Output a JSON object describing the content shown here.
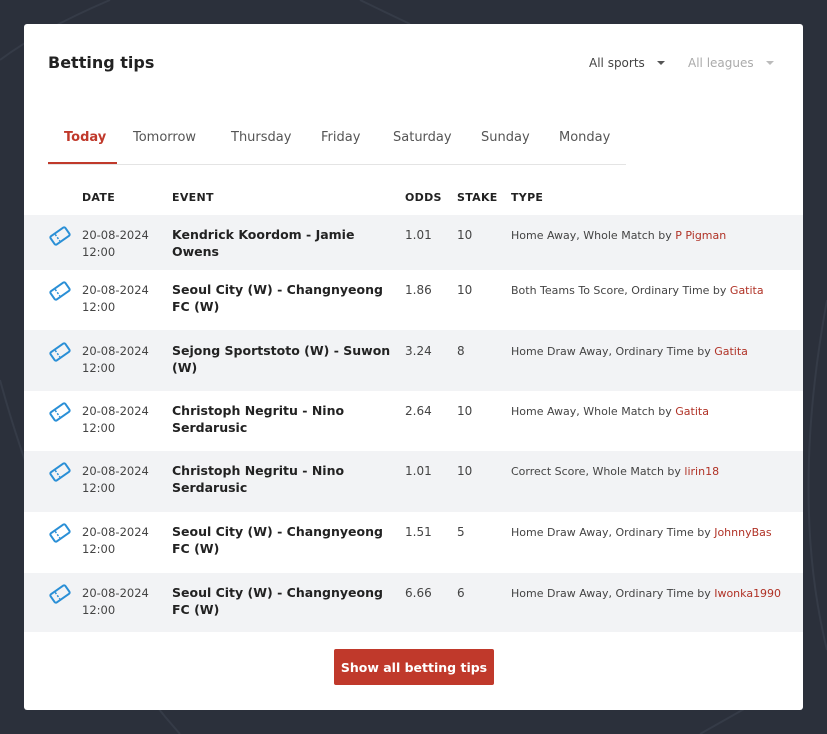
{
  "widget": {
    "title": "Betting tips",
    "filters": {
      "sports": "All sports",
      "leagues": "All leagues"
    },
    "tabs": [
      "Today",
      "Tomorrow",
      "Thursday",
      "Friday",
      "Saturday",
      "Sunday",
      "Monday"
    ],
    "active_tab": "Today",
    "columns": {
      "date": "DATE",
      "event": "EVENT",
      "odds": "ODDS",
      "stake": "STAKE",
      "type": "TYPE"
    },
    "rows": [
      {
        "date": "20-08-2024",
        "time": "12:00",
        "event": "Kendrick Koordom - Jamie Owens",
        "odds": "1.01",
        "stake": "10",
        "type": "Home Away, Whole Match by ",
        "user": "P Pigman"
      },
      {
        "date": "20-08-2024",
        "time": "12:00",
        "event": "Seoul City (W) - Changnyeong FC (W)",
        "odds": "1.86",
        "stake": "10",
        "type": "Both Teams To Score, Ordinary Time by ",
        "user": "Gatita"
      },
      {
        "date": "20-08-2024",
        "time": "12:00",
        "event": "Sejong Sportstoto (W) - Suwon (W)",
        "odds": "3.24",
        "stake": "8",
        "type": "Home Draw Away, Ordinary Time by ",
        "user": "Gatita"
      },
      {
        "date": "20-08-2024",
        "time": "12:00",
        "event": "Christoph Negritu - Nino Serdarusic",
        "odds": "2.64",
        "stake": "10",
        "type": "Home Away, Whole Match by ",
        "user": "Gatita"
      },
      {
        "date": "20-08-2024",
        "time": "12:00",
        "event": "Christoph Negritu - Nino Serdarusic",
        "odds": "1.01",
        "stake": "10",
        "type": "Correct Score, Whole Match by ",
        "user": "lirin18"
      },
      {
        "date": "20-08-2024",
        "time": "12:00",
        "event": "Seoul City (W) - Changnyeong FC (W)",
        "odds": "1.51",
        "stake": "5",
        "type": "Home Draw Away, Ordinary Time by ",
        "user": "JohnnyBas"
      },
      {
        "date": "20-08-2024",
        "time": "12:00",
        "event": "Seoul City (W) - Changnyeong FC (W)",
        "odds": "6.66",
        "stake": "6",
        "type": "Home Draw Away, Ordinary Time by ",
        "user": "Iwonka1990"
      }
    ],
    "show_all_label": "Show all betting tips",
    "colors": {
      "accent": "#c0392b",
      "ticket_icon": "#2a8fd6",
      "background": "#2b303b"
    },
    "icons": {
      "row": "ticket-icon",
      "dropdown": "caret-down-icon"
    }
  }
}
